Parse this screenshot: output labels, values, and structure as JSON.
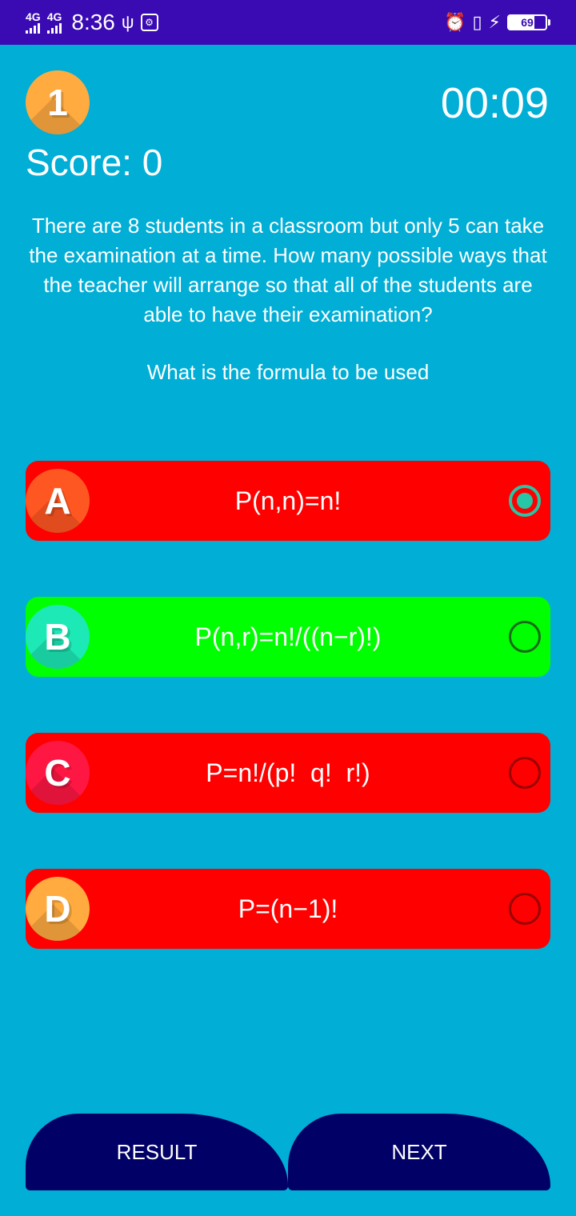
{
  "status_bar": {
    "net1": "4G",
    "net2": "4G",
    "time": "8:36",
    "usb_icon": "usb-icon",
    "battery": "69",
    "battery_level": 0.69
  },
  "header": {
    "question_number": "1",
    "timer": "00:09",
    "score": "Score: 0"
  },
  "question": {
    "text": "There are 8 students in a classroom but only 5 can take the examination at a time. How many possible ways that the teacher will arrange so that all of the students are able to have their examination?",
    "prompt": "What is the formula to be used"
  },
  "options": [
    {
      "letter": "A",
      "text": "P(n,n)=n!",
      "color": "#ff0000",
      "badge_color": "#ff5722",
      "selected": true
    },
    {
      "letter": "B",
      "text": "P(n,r)=n!/((n−r)!)",
      "color": "#00ff00",
      "badge_color": "#1de9b6",
      "selected": false
    },
    {
      "letter": "C",
      "text": "P=n!/(p!  q!  r!)",
      "color": "#ff0000",
      "badge_color": "#ff1744",
      "selected": false
    },
    {
      "letter": "D",
      "text": "P=(n−1)!",
      "color": "#ff0000",
      "badge_color": "#ffab40",
      "selected": false
    }
  ],
  "buttons": {
    "result": "RESULT",
    "next": "NEXT"
  },
  "colors": {
    "background": "#00aed6",
    "status_bar": "#3a0ab3",
    "button": "#010066"
  }
}
